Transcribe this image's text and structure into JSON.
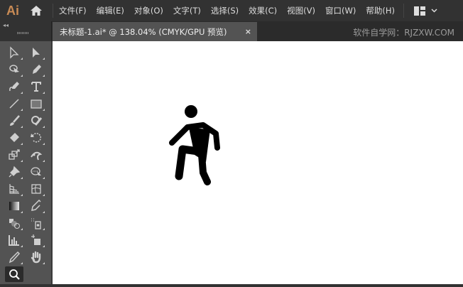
{
  "app": {
    "logo": "Ai"
  },
  "menu": [
    "文件(F)",
    "编辑(E)",
    "对象(O)",
    "文字(T)",
    "选择(S)",
    "效果(C)",
    "视图(V)",
    "窗口(W)",
    "帮助(H)"
  ],
  "document_tab": {
    "title": "未标题-1.ai* @ 138.04% (CMYK/GPU 预览)",
    "close": "×"
  },
  "watermark": "软件自学网：RJZXW.COM",
  "tools": [
    "selection-tool",
    "direct-selection-tool",
    "lasso-tool",
    "pen-tool",
    "curvature-tool",
    "type-tool",
    "line-tool",
    "rectangle-tool",
    "paintbrush-tool",
    "shaper-tool",
    "eraser-tool",
    "rotate-tool",
    "scale-tool",
    "puppet-warp-tool",
    "pin-tool",
    "shape-builder-tool",
    "perspective-grid-tool",
    "mesh-tool",
    "gradient-tool",
    "eyedropper-tool",
    "blend-tool",
    "symbol-sprayer-tool",
    "column-graph-tool",
    "artboard-tool",
    "pencil-tool",
    "hand-tool",
    "zoom-tool"
  ],
  "colors": {
    "accent": "#c98b55",
    "panel": "#535353",
    "menubar": "#323232"
  }
}
